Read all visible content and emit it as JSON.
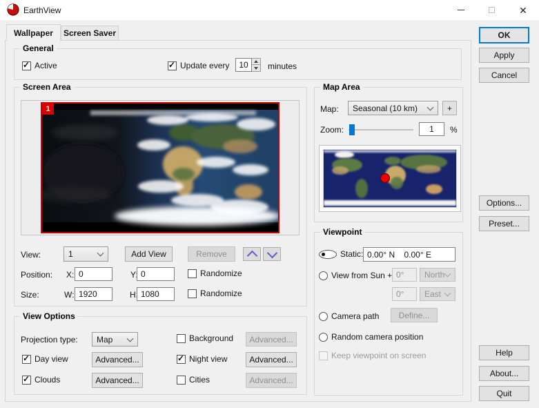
{
  "window": {
    "title": "EarthView"
  },
  "tabs": {
    "wallpaper": "Wallpaper",
    "screensaver": "Screen Saver"
  },
  "general": {
    "title": "General",
    "active": "Active",
    "update_every": "Update every",
    "interval": "10",
    "minutes": "minutes"
  },
  "screen_area": {
    "title": "Screen Area",
    "view_badge": "1",
    "view_label": "View:",
    "view_value": "1",
    "add_view": "Add View",
    "remove": "Remove",
    "position_label": "Position:",
    "x_label": "X:",
    "x_value": "0",
    "y_label": "Y:",
    "y_value": "0",
    "size_label": "Size:",
    "w_label": "W:",
    "w_value": "1920",
    "h_label": "H:",
    "h_value": "1080",
    "randomize": "Randomize"
  },
  "map_area": {
    "title": "Map Area",
    "map_label": "Map:",
    "map_value": "Seasonal (10 km)",
    "add_map": "+",
    "zoom_label": "Zoom:",
    "zoom_value": "1",
    "zoom_unit": "%"
  },
  "viewpoint": {
    "title": "Viewpoint",
    "static_label": "Static:",
    "static_value": "0.00° N    0.00° E",
    "sun_label": "View from Sun +",
    "lat_offset": "0°",
    "lat_dir": "North",
    "lon_offset": "0°",
    "lon_dir": "East",
    "camera_path": "Camera path",
    "define": "Define...",
    "random_camera": "Random camera position",
    "keep_viewpoint": "Keep viewpoint on screen"
  },
  "view_options": {
    "title": "View Options",
    "projection_label": "Projection type:",
    "projection_value": "Map",
    "background": "Background",
    "day_view": "Day view",
    "night_view": "Night view",
    "clouds": "Clouds",
    "cities": "Cities",
    "advanced": "Advanced..."
  },
  "action_buttons": {
    "ok": "OK",
    "apply": "Apply",
    "cancel": "Cancel",
    "options": "Options...",
    "preset": "Preset...",
    "help": "Help",
    "about": "About...",
    "quit": "Quit"
  },
  "colors": {
    "accent": "#0078d7",
    "selection_red": "#cc0000",
    "arrow_blue": "#5c5cc8"
  }
}
